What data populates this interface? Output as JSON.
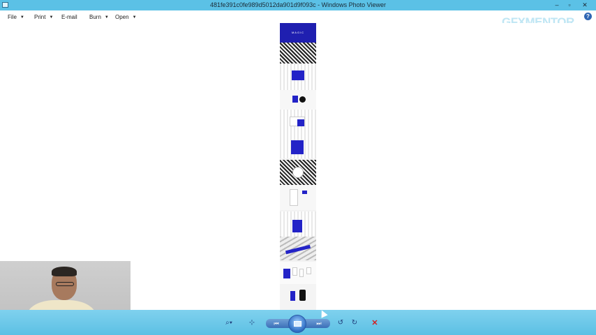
{
  "window": {
    "title": "481fe391c0fe989d5012da901d9f093c - Windows Photo Viewer",
    "icons": {
      "app": "photo-viewer-icon",
      "minimize": "minimize-icon",
      "maximize": "maximize-icon",
      "close": "close-icon"
    },
    "controls": {
      "minimize": "–",
      "maximize": "▫",
      "close": "✕"
    }
  },
  "menubar": {
    "items": [
      {
        "label": "File",
        "dropdown": true
      },
      {
        "label": "Print",
        "dropdown": true
      },
      {
        "label": "E-mail",
        "dropdown": false
      },
      {
        "label": "Burn",
        "dropdown": true
      },
      {
        "label": "Open",
        "dropdown": true
      }
    ],
    "help": "?"
  },
  "watermark": {
    "text": "GFXMENTOR"
  },
  "image": {
    "brand_text": "MAGIC",
    "accent_color": "#2323c7"
  },
  "toolbar": {
    "zoom_icon": "magnifier-icon",
    "fit_icon": "actual-size-icon",
    "prev_icon": "previous-icon",
    "slideshow_icon": "slideshow-icon",
    "next_icon": "next-icon",
    "rotate_ccw_icon": "rotate-counterclockwise-icon",
    "rotate_cw_icon": "rotate-clockwise-icon",
    "delete_icon": "delete-icon",
    "glyphs": {
      "zoom": "⌕▾",
      "fit": "⊹",
      "prev": "⏮",
      "next": "⏭",
      "rotate_ccw": "↺",
      "rotate_cw": "↻",
      "delete": "✕"
    }
  }
}
